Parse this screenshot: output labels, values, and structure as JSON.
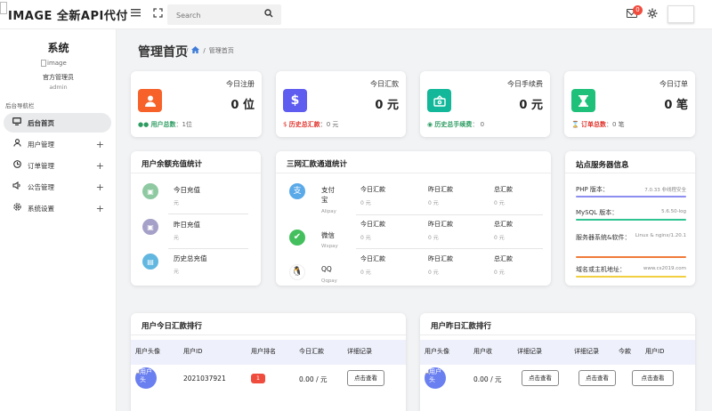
{
  "topbar": {
    "brand": "IMAGE 全新API代付",
    "search_placeholder": "Search",
    "notification_count": "0"
  },
  "sidebar": {
    "title": "系统",
    "image_alt": "image",
    "username": "官方管理员",
    "role": "admin",
    "nav_label": "后台导航栏",
    "items": [
      {
        "label": "后台首页",
        "icon": "monitor-icon"
      },
      {
        "label": "用户管理",
        "icon": "user-icon"
      },
      {
        "label": "订单管理",
        "icon": "clock-icon"
      },
      {
        "label": "公告管理",
        "icon": "speaker-icon"
      },
      {
        "label": "系统设置",
        "icon": "gear-icon"
      }
    ]
  },
  "header": {
    "title": "管理首页",
    "breadcrumb": "管理首页"
  },
  "stats": [
    {
      "title": "今日注册",
      "value": "0 位",
      "foot_label": "用户总数",
      "foot_value": "：1位",
      "color": "#f6622a",
      "foot_color": "#2c9c61",
      "icon": "user-icon"
    },
    {
      "title": "今日汇款",
      "value": "0 元",
      "foot_label": "历史总汇款",
      "foot_value": "：0 元",
      "color": "#5f5cf0",
      "foot_color": "#e0342c",
      "icon": "dollar-icon"
    },
    {
      "title": "今日手续费",
      "value": "0 元",
      "foot_label": "历史总手续费",
      "foot_value": "： 0",
      "color": "#13b89a",
      "foot_color": "#2c9c61",
      "icon": "money-bag-icon"
    },
    {
      "title": "今日订单",
      "value": "0 笔",
      "foot_label": "订单总数",
      "foot_value": "：0 笔",
      "color": "#1fc07a",
      "foot_color": "#e0342c",
      "icon": "hourglass-icon"
    }
  ],
  "recharge": {
    "title": "用户余额充值统计",
    "items": [
      {
        "label": "今日充值",
        "sub": "元",
        "color": "#8ec9a1"
      },
      {
        "label": "昨日充值",
        "sub": "元",
        "color": "#a5a0c8"
      },
      {
        "label": "历史总充值",
        "sub": "元",
        "color": "#62b7e0"
      }
    ]
  },
  "channels": {
    "title": "三网汇款通道统计",
    "cols": [
      "今日汇款",
      "昨日汇款",
      "总汇款"
    ],
    "rows": [
      {
        "name": "支付宝",
        "sub": "Alipay",
        "values": [
          "0 元",
          "0 元",
          "0 元"
        ],
        "icon": "alipay-icon"
      },
      {
        "name": "微信",
        "sub": "Wxpay",
        "values": [
          "0 元",
          "0 元",
          "0 元"
        ],
        "icon": "wechat-icon"
      },
      {
        "name": "QQ",
        "sub": "Qqpay",
        "values": [
          "0 元",
          "0 元",
          "0 元"
        ],
        "icon": "qq-icon"
      }
    ]
  },
  "server": {
    "title": "站点服务器信息",
    "rows": [
      {
        "key": "PHP 版本：",
        "value": "7.0.33 非线程安全",
        "color": "#8c8ef0"
      },
      {
        "key": "MySQL 版本：",
        "value": "5.6.50-log",
        "color": "#2fc391"
      },
      {
        "key": "服务器系统&软件：",
        "value": "Linux & nginx/1.20.1",
        "color": "#f07a3a"
      },
      {
        "key": "域名或主机地址：",
        "value": "www.cs2019.com",
        "color": "#f1cf3f"
      }
    ]
  },
  "today_rank": {
    "title": "用户今日汇款排行",
    "headers": [
      "用户头像",
      "用户ID",
      "用户排名",
      "今日汇款",
      "详细记录"
    ],
    "row": {
      "avatar": "用户头",
      "id": "2021037921",
      "rank": "1",
      "amount": "0.00 / 元",
      "button": "点击查看"
    }
  },
  "yesterday_rank": {
    "title": "用户昨日汇款排行",
    "headers": [
      "用户头像",
      "用户收",
      "详细记录",
      "详细记录",
      "今款",
      "用户ID"
    ],
    "row": {
      "avatar": "用户头",
      "amount": "0.00 / 元",
      "buttons": [
        "点击查看",
        "点击查看",
        "点击查看"
      ]
    }
  }
}
